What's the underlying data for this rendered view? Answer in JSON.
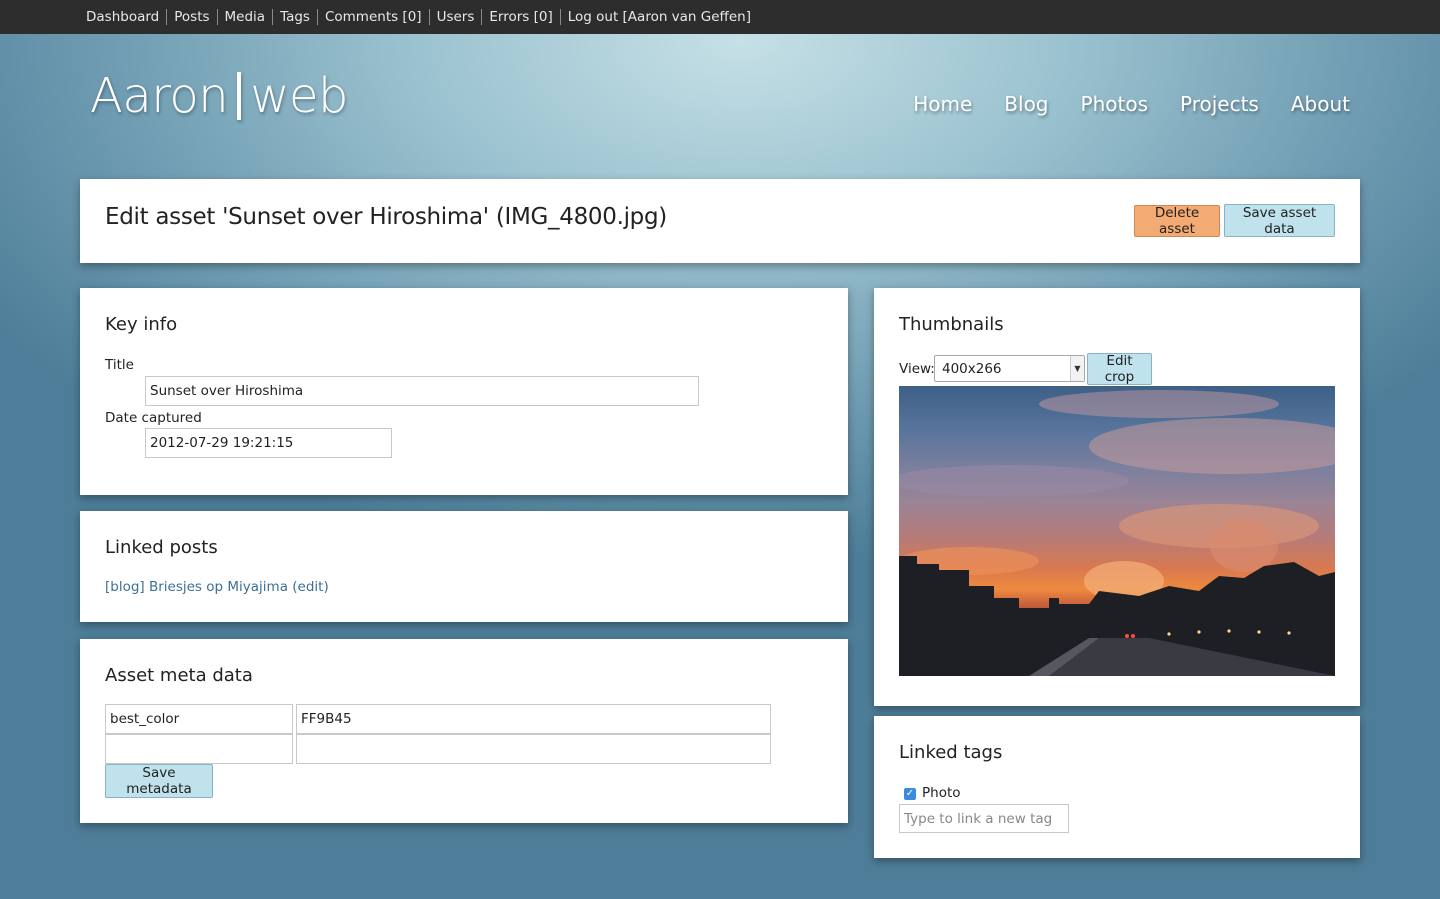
{
  "adminbar": {
    "items": [
      "Dashboard",
      "Posts",
      "Media",
      "Tags",
      "Comments [0]",
      "Users",
      "Errors [0]",
      "Log out [Aaron van Geffen]"
    ]
  },
  "header": {
    "logo_left": "Aaron",
    "logo_right": "web",
    "nav": [
      "Home",
      "Blog",
      "Photos",
      "Projects",
      "About"
    ]
  },
  "page": {
    "title": "Edit asset 'Sunset over Hiroshima' (IMG_4800.jpg)",
    "delete_label": "Delete asset",
    "save_label": "Save asset data"
  },
  "key_info": {
    "heading": "Key info",
    "title_label": "Title",
    "title_value": "Sunset over Hiroshima",
    "date_label": "Date captured",
    "date_value": "2012-07-29 19:21:15"
  },
  "linked_posts": {
    "heading": "Linked posts",
    "items": [
      "[blog] Briesjes op Miyajima (edit)"
    ]
  },
  "meta": {
    "heading": "Asset meta data",
    "rows": [
      {
        "key": "best_color",
        "value": "FF9B45"
      },
      {
        "key": "",
        "value": ""
      }
    ],
    "save_label": "Save metadata"
  },
  "thumbnails": {
    "heading": "Thumbnails",
    "view_label": "View:",
    "view_selected": "400x266",
    "edit_crop_label": "Edit crop"
  },
  "tags": {
    "heading": "Linked tags",
    "items": [
      {
        "label": "Photo",
        "checked": true
      }
    ],
    "new_tag_placeholder": "Type to link a new tag"
  },
  "colors": {
    "accent_button": "#bfe2ec",
    "danger_button": "#f3aa73",
    "link": "#3c6f98",
    "adminbar": "#2d2d2d"
  }
}
